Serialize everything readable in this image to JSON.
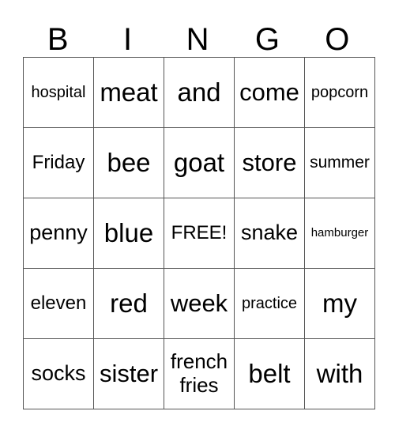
{
  "header": [
    "B",
    "I",
    "N",
    "G",
    "O"
  ],
  "rows": [
    [
      "hospital",
      "meat",
      "and",
      "come",
      "popcorn"
    ],
    [
      "Friday",
      "bee",
      "goat",
      "store",
      "summer"
    ],
    [
      "penny",
      "blue",
      "FREE!",
      "snake",
      "hamburger"
    ],
    [
      "eleven",
      "red",
      "week",
      "practice",
      "my"
    ],
    [
      "socks",
      "sister",
      "french fries",
      "belt",
      "with"
    ]
  ]
}
